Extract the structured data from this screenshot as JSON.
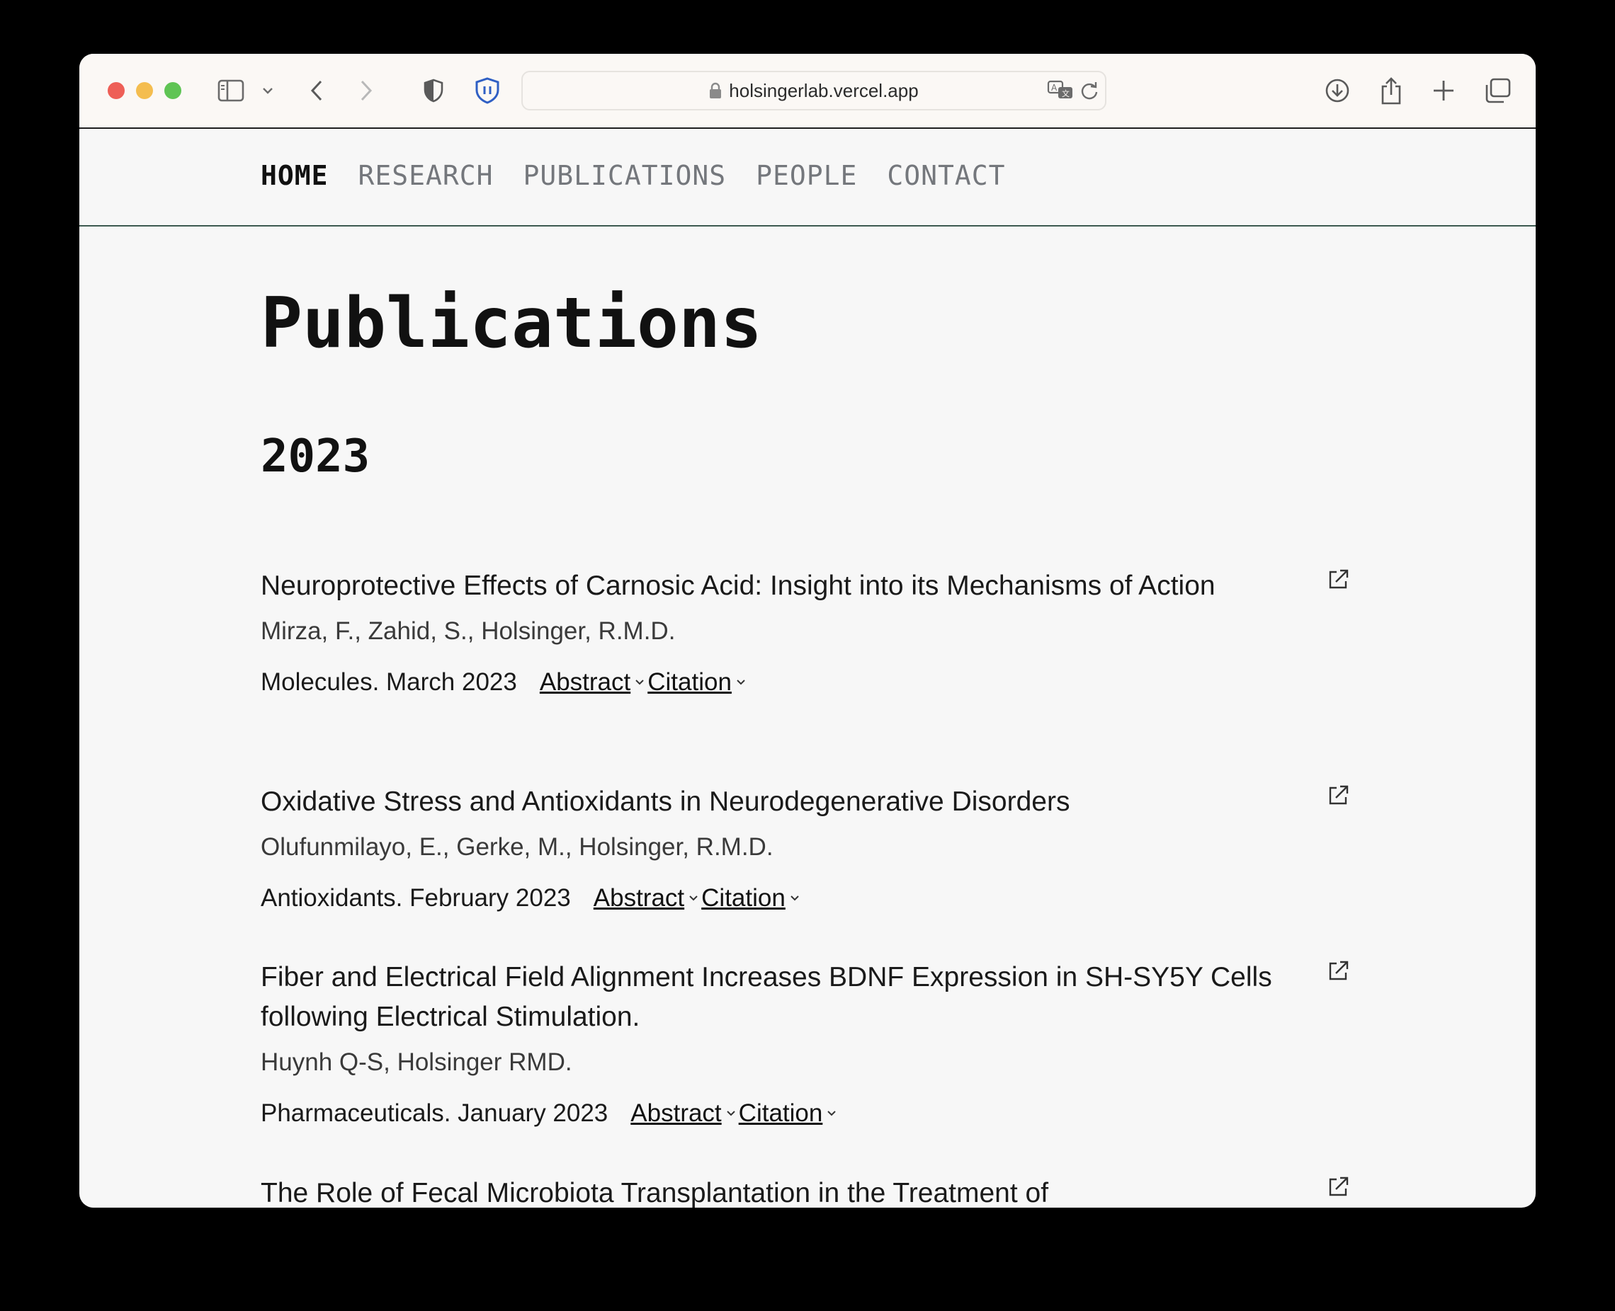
{
  "browser": {
    "url": "holsingerlab.vercel.app"
  },
  "nav": {
    "items": [
      {
        "label": "HOME",
        "active": true
      },
      {
        "label": "RESEARCH",
        "active": false
      },
      {
        "label": "PUBLICATIONS",
        "active": false
      },
      {
        "label": "PEOPLE",
        "active": false
      },
      {
        "label": "CONTACT",
        "active": false
      }
    ]
  },
  "page": {
    "title": "Publications",
    "year": "2023",
    "abstract_label": "Abstract",
    "citation_label": "Citation"
  },
  "publications": [
    {
      "title": "Neuroprotective Effects of Carnosic Acid: Insight into its Mechanisms of Action",
      "authors": "Mirza, F., Zahid, S., Holsinger, R.M.D.",
      "journal": "Molecules. March 2023"
    },
    {
      "title": "Oxidative Stress and Antioxidants in Neurodegenerative Disorders",
      "authors": "Olufunmilayo, E., Gerke, M., Holsinger, R.M.D.",
      "journal": "Antioxidants. February 2023"
    },
    {
      "title": "Fiber and Electrical Field Alignment Increases BDNF Expression in SH-SY5Y Cells following Electrical Stimulation.",
      "authors": "Huynh Q-S, Holsinger RMD.",
      "journal": "Pharmaceuticals. January 2023"
    },
    {
      "title": "The Role of Fecal Microbiota Transplantation in the Treatment of Neurodegenerative Diseases: A Review",
      "authors": "",
      "journal": ""
    }
  ]
}
